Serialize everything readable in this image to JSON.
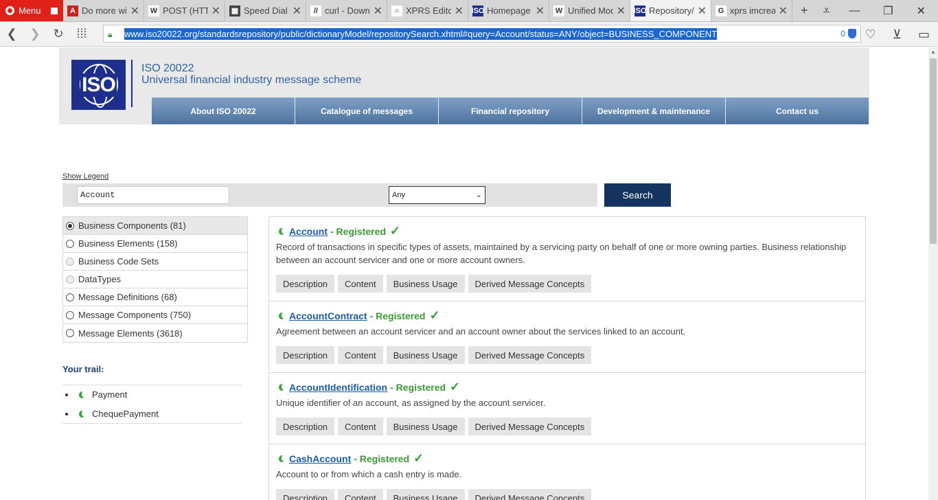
{
  "browser": {
    "menu_label": "Menu",
    "tabs": [
      {
        "title": "Do more wit",
        "fav_color": "#cc1f1f",
        "fav_text": "A"
      },
      {
        "title": "POST (HTTP",
        "fav_color": "#ffffff",
        "fav_text": "W"
      },
      {
        "title": "Speed Dial",
        "fav_color": "#444444",
        "fav_text": "▦"
      },
      {
        "title": "curl - Downl",
        "fav_color": "#ffffff",
        "fav_text": "//"
      },
      {
        "title": "XPRS Editor",
        "fav_color": "#ffffff",
        "fav_text": "○"
      },
      {
        "title": "Homepage |",
        "fav_color": "#1c2f8d",
        "fav_text": "ISO"
      },
      {
        "title": "Unified Mod",
        "fav_color": "#ffffff",
        "fav_text": "W"
      },
      {
        "title": "Repository/",
        "fav_color": "#1c2f8d",
        "fav_text": "ISO"
      },
      {
        "title": "xprs imcreat",
        "fav_color": "#ffffff",
        "fav_text": "G"
      }
    ],
    "url": "www.iso20022.org/standardsrepository/public/dictionaryModel/repositorySearch.xhtml#query=Account/status=ANY/object=BUSINESS_COMPONENT",
    "blocked_count": "0"
  },
  "header": {
    "title": "ISO 20022",
    "subtitle": "Universal financial industry message scheme",
    "logo_text": "ISO",
    "nav": [
      "About ISO 20022",
      "Catalogue of messages",
      "Financial repository",
      "Development & maintenance",
      "Contact us"
    ]
  },
  "search": {
    "legend_link": "Show Legend",
    "query": "Account",
    "status": "Any",
    "button": "Search"
  },
  "filters": [
    {
      "label": "Business Components (81)",
      "state": "checked"
    },
    {
      "label": "Business Elements (158)",
      "state": "enabled"
    },
    {
      "label": "Business Code Sets",
      "state": "disabled"
    },
    {
      "label": "DataTypes",
      "state": "disabled"
    },
    {
      "label": "Message Definitions (68)",
      "state": "enabled"
    },
    {
      "label": "Message Components (750)",
      "state": "enabled"
    },
    {
      "label": "Message Elements (3618)",
      "state": "enabled"
    }
  ],
  "trail": {
    "title": "Your trail:",
    "items": [
      "Payment",
      "ChequePayment"
    ]
  },
  "results": [
    {
      "name": "Account",
      "status": "- Registered",
      "description": "Record of transactions in specific types of assets, maintained by a servicing party on behalf of one or more owning parties. Business relationship between an account servicer and one or more account owners.",
      "buttons": [
        "Description",
        "Content",
        "Business Usage",
        "Derived Message Concepts"
      ]
    },
    {
      "name": "AccountContract",
      "status": "- Registered",
      "description": "Agreement between an account servicer and an account owner about the services linked to an account.",
      "buttons": [
        "Description",
        "Content",
        "Business Usage",
        "Derived Message Concepts"
      ]
    },
    {
      "name": "AccountIdentification",
      "status": "- Registered",
      "description": "Unique identifier of an account, as assigned by the account servicer.",
      "buttons": [
        "Description",
        "Content",
        "Business Usage",
        "Derived Message Concepts"
      ]
    },
    {
      "name": "CashAccount",
      "status": "- Registered",
      "description": "Account to or from which a cash entry is made.",
      "buttons": [
        "Description",
        "Content",
        "Business Usage",
        "Derived Message Concepts"
      ]
    }
  ]
}
